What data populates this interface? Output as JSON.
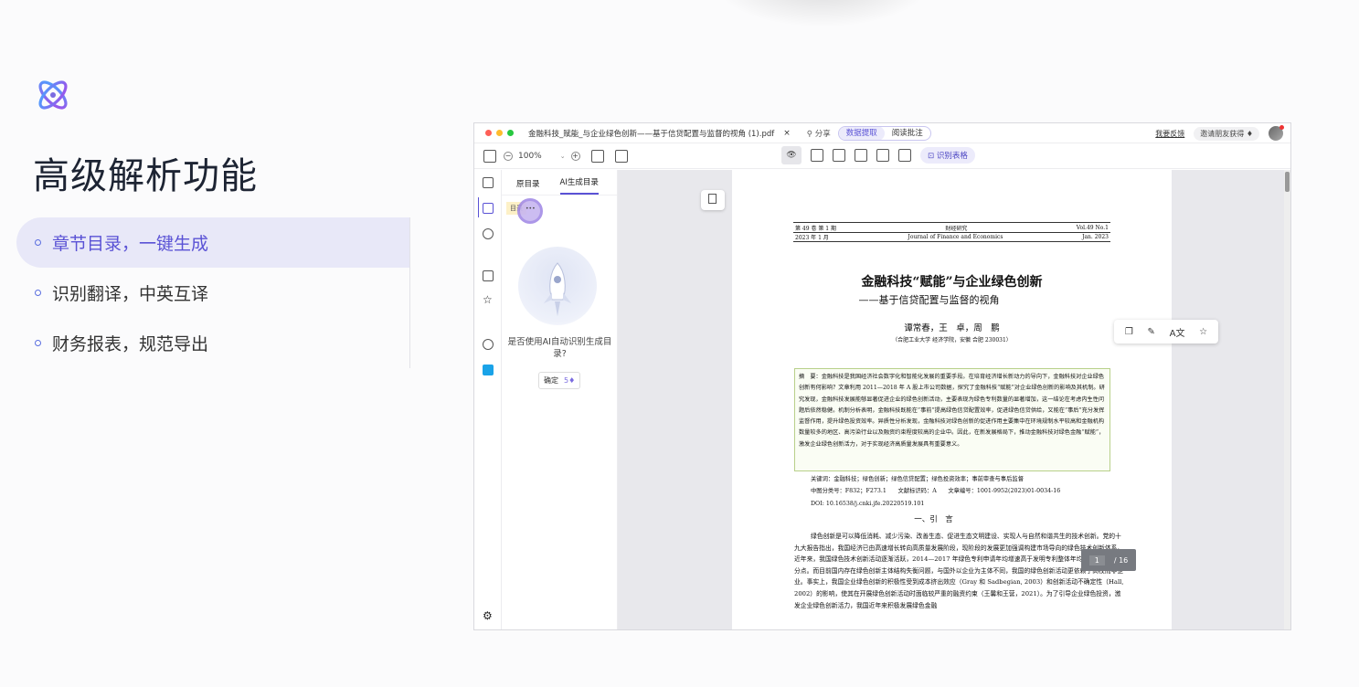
{
  "hero": {
    "title": "高级解析功能",
    "features": [
      {
        "label": "章节目录，一键生成",
        "active": true
      },
      {
        "label": "识别翻译，中英互译",
        "active": false
      },
      {
        "label": "财务报表，规范导出",
        "active": false
      }
    ]
  },
  "app": {
    "titlebar": {
      "doc_title": "金融科技_赋能_与企业绿色创新——基于信贷配置与监督的视角 (1).pdf",
      "close": "×",
      "share": "分享",
      "modes": [
        "数据提取",
        "阅读批注"
      ],
      "feedback": "我要反馈",
      "invite": "邀请朋友获得"
    },
    "toolbar": {
      "zoom": "100%",
      "ocr_table": "识别表格"
    },
    "panel": {
      "tabs": [
        "原目录",
        "AI生成目录"
      ],
      "toc_row": "目录",
      "prompt": "是否使用AI自动识别生成目录?",
      "confirm": "确定",
      "confirm_cost": "5"
    },
    "page": {
      "header_row1": [
        "第 49 卷  第 1 期",
        "财经研究",
        "Vol.49 No.1"
      ],
      "header_row2": [
        "2023 年 1 月",
        "Journal of Finance and Economics",
        "Jan. 2023"
      ],
      "title": "金融科技“赋能”与企业绿色创新",
      "subtitle": "——基于信贷配置与监督的视角",
      "authors": "谭常春，王　卓，周　鹏",
      "affiliation": "（合肥工业大学 经济学院，安徽 合肥 230031）",
      "abstract": "摘　要：金融科技是我国经济社会数字化和智能化发展的重要手段。在培育经济增长新动力的导向下，金融科技对企业绿色创新有何影响？文章利用 2011—2018 年 A 股上市公司数据，探究了金融科技“赋能”对企业绿色创新的影响及其机制。研究发现，金融科技发展能够显著促进企业的绿色创新活动，主要表现为绿色专利数量的显著增加，这一结论在考虑内生性问题后依然稳健。机制分析表明，金融科技既能在“事前”提高绿色信贷配置效率，促进绿色信贷供给，又能在“事后”充分发挥监督作用，提升绿色投资效率。异质性分析发现，金融科技对绿色创新的促进作用主要集中在环境规制水平较高和金融机构数量较多的地区、高污染行业以及融资约束程度较高的企业中。因此，在新发展格局下，推动金融科技对绿色金融“赋能”，激发企业绿色创新活力，对于实现经济高质量发展具有重要意义。",
      "keywords": "关键词：金融科技；绿色创新；绿色信贷配置；绿色投资效率；事前审查与事后监督",
      "classification": "中图分类号：F832；F273.1　　文献标识码：A　　文章编号：1001-9952(2023)01-0034-16",
      "doi": "DOI: 10.16538/j.cnki.jfe.20220519.101",
      "section": "一、引　言",
      "body": [
        "绿色创新是可以降低消耗、减少污染、改善生态、促进生态文明建设、实现人与自然和谐共生的技术创新。党的十九大报告指出，我国经济已由高速增长转向高质量发展阶段，现阶段的发展更加强调构建市场导向的绿色技术创新体系。近年来，我国绿色技术创新活动逐渐活跃，2014—2017 年绿色专利申请年均增速高于发明专利整体年均增速 3.7 个百分点。而目前国内存在绿色创新主体结构失衡问题，与国外以企业为主体不同，我国的绿色创新活动更依赖于高校而非企业。事实上，我国企业绿色创新的积极性受到成本挤出效应（Gray 和 Sadbegian, 2003）和创新活动不确定性（Hall, 2002）的影响，使其在开展绿色创新活动时面临较严重的融资约束（王馨和王营，2021）。为了引导企业绿色投资，激发企业绿色创新活力，我国近年来积极发展绿色金融"
      ]
    },
    "pagination": {
      "current": "1",
      "total": "/ 16"
    }
  },
  "colors": {
    "accent": "#5a52d5",
    "active_bg": "#e8e8f8"
  }
}
